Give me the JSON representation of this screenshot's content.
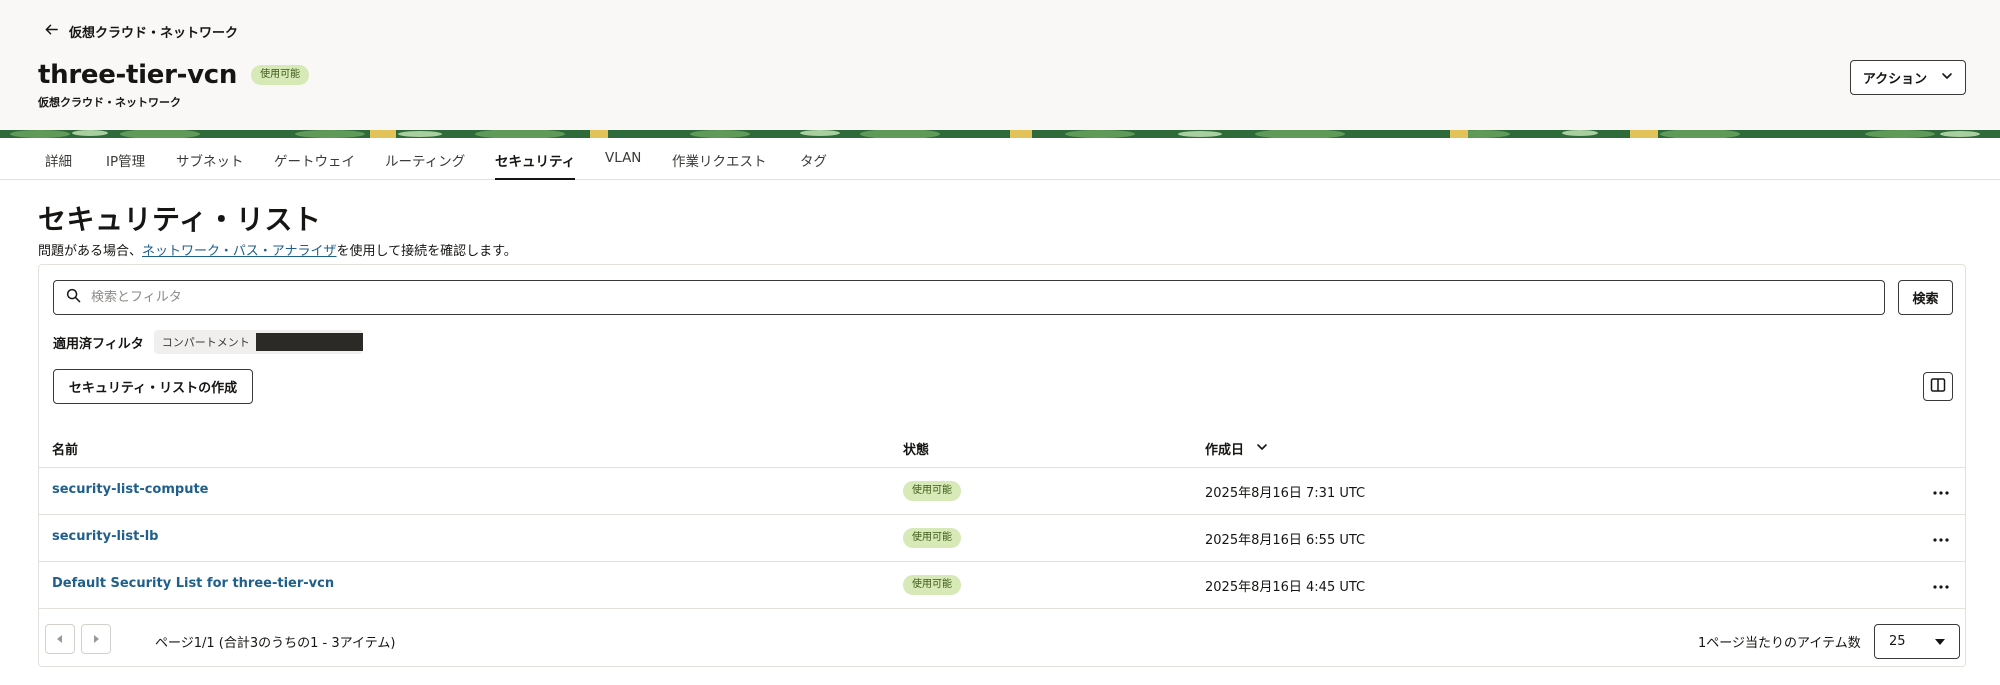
{
  "header": {
    "back_label": "仮想クラウド・ネットワーク",
    "title": "three-tier-vcn",
    "status_badge": "使用可能",
    "subtitle": "仮想クラウド・ネットワーク",
    "actions_label": "アクション"
  },
  "tabs": [
    {
      "label": "詳細"
    },
    {
      "label": "IP管理"
    },
    {
      "label": "サブネット"
    },
    {
      "label": "ゲートウェイ"
    },
    {
      "label": "ルーティング"
    },
    {
      "label": "セキュリティ",
      "active": true
    },
    {
      "label": "VLAN"
    },
    {
      "label": "作業リクエスト"
    },
    {
      "label": "タグ"
    }
  ],
  "section": {
    "title": "セキュリティ・リスト",
    "help_prefix": "問題がある場合、",
    "help_link": "ネットワーク・パス・アナライザ",
    "help_suffix": "を使用して接続を確認します。"
  },
  "search": {
    "placeholder": "検索とフィルタ",
    "button_label": "検索"
  },
  "filters": {
    "label": "適用済フィルタ",
    "chip_label": "コンパートメント"
  },
  "create_button_label": "セキュリティ・リストの作成",
  "table": {
    "columns": [
      "名前",
      "状態",
      "作成日"
    ],
    "sort_column": "作成日",
    "rows": [
      {
        "name": "security-list-compute",
        "status": "使用可能",
        "created": "2025年8月16日 7:31 UTC"
      },
      {
        "name": "security-list-lb",
        "status": "使用可能",
        "created": "2025年8月16日 6:55 UTC"
      },
      {
        "name": "Default Security List for three-tier-vcn",
        "status": "使用可能",
        "created": "2025年8月16日 4:45 UTC"
      }
    ]
  },
  "pagination": {
    "page_info": "ページ1/1 (合計3のうちの1 - 3アイテム)",
    "per_page_label": "1ページ当たりのアイテム数",
    "per_page_value": "25"
  },
  "colors": {
    "link": "#1f5f8b",
    "badge_bg": "#d6e9b7",
    "header_bg": "#f9f8f6",
    "banner_green": "#2f6b3a",
    "banner_yellow": "#e2c35a"
  },
  "icons": [
    "arrow-left-icon",
    "chevron-down-icon",
    "search-icon",
    "columns-icon",
    "more-icon",
    "chevron-left-icon",
    "chevron-right-icon"
  ]
}
